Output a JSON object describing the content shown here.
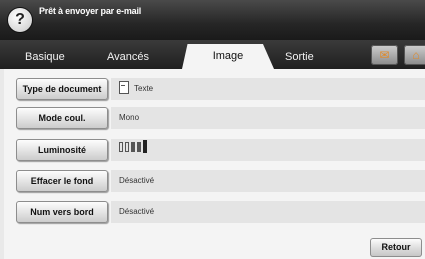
{
  "header": {
    "help_icon": "help-icon",
    "help_glyph": "?",
    "title": "Prêt à envoyer par e-mail"
  },
  "tabs": [
    {
      "label": "Basique",
      "active": false
    },
    {
      "label": "Avancés",
      "active": false
    },
    {
      "label": "Image",
      "active": true
    },
    {
      "label": "Sortie",
      "active": false
    }
  ],
  "tab_icons": [
    {
      "name": "address-book-icon",
      "glyph": "✉"
    },
    {
      "name": "home-icon",
      "glyph": "⌂"
    }
  ],
  "settings": [
    {
      "label": "Type de document",
      "value": "Texte",
      "icon": "document-icon"
    },
    {
      "label": "Mode coul.",
      "value": "Mono"
    },
    {
      "label": "Luminosité",
      "value": "",
      "brightness_levels": 5,
      "brightness_current": 5
    },
    {
      "label": "Effacer le fond",
      "value": "Désactivé"
    },
    {
      "label": "Num vers bord",
      "value": "Désactivé"
    }
  ],
  "footer": {
    "back_label": "Retour"
  },
  "colors": {
    "header_bg": "#262626",
    "panel_bg": "#f4f4f4",
    "accent_icon": "#e08a2a"
  }
}
